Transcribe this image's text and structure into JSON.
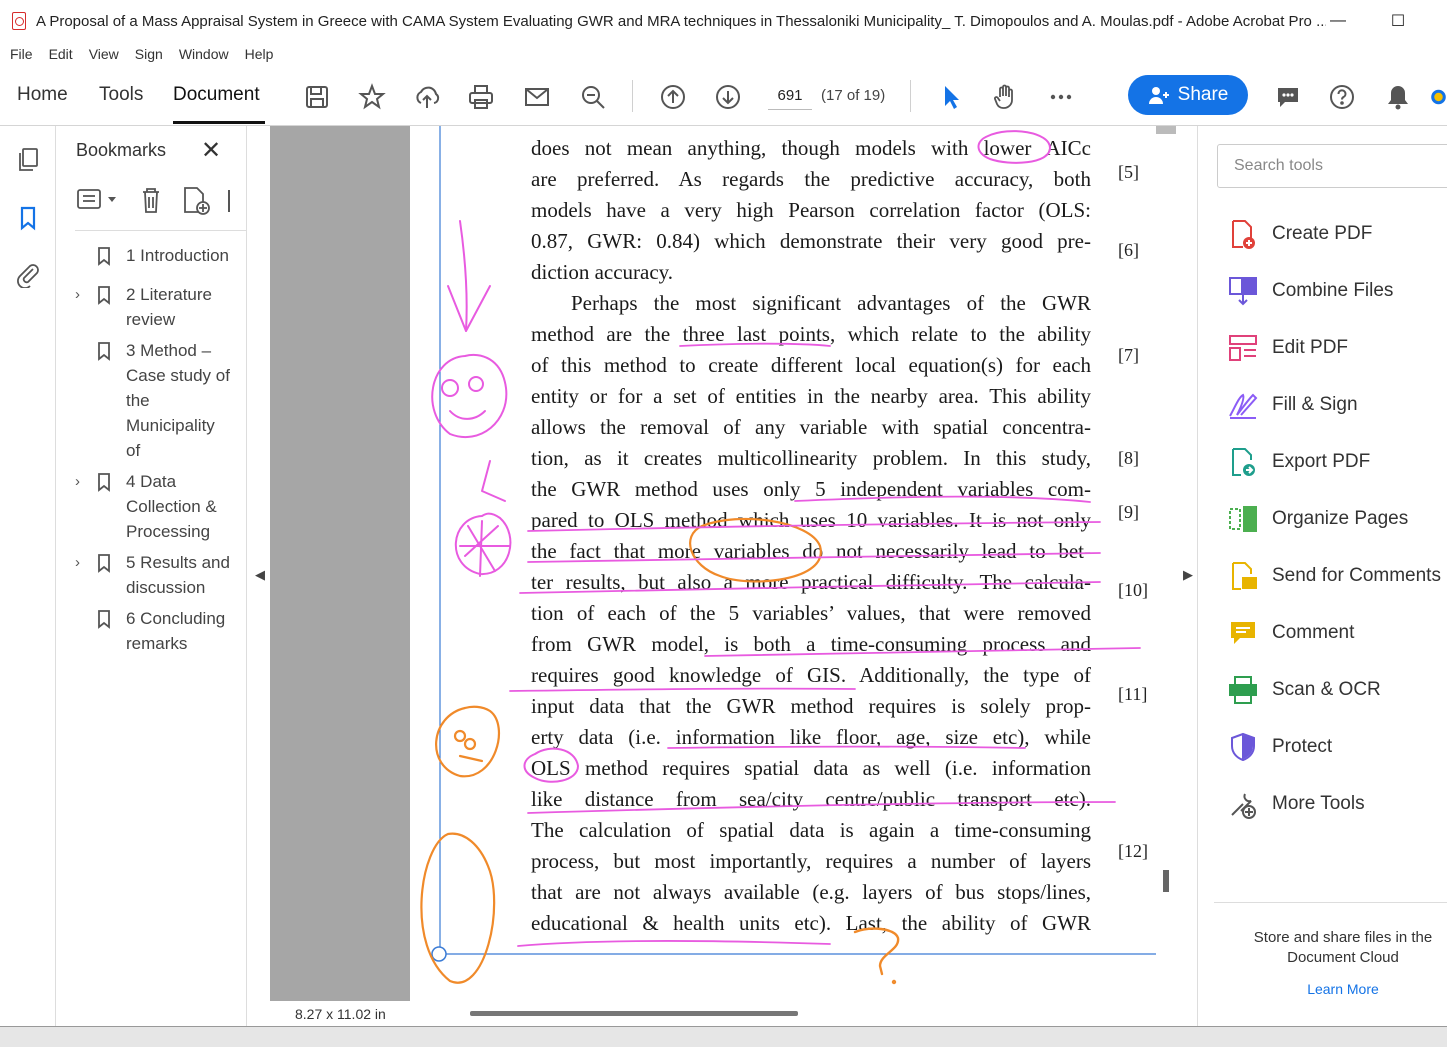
{
  "window": {
    "title": "A Proposal of a Mass Appraisal System in Greece with CAMA System Evaluating GWR and MRA techniques in Thessaloniki Municipality_ T. Dimopoulos and A. Moulas.pdf - Adobe Acrobat Pro ...",
    "minimize": "—",
    "maximize": "☐"
  },
  "menu": [
    "File",
    "Edit",
    "View",
    "Sign",
    "Window",
    "Help"
  ],
  "tabs": {
    "home": "Home",
    "tools": "Tools",
    "document": "Document"
  },
  "toolbar": {
    "page_value": "691",
    "page_count": "(17 of 19)",
    "share_label": "Share"
  },
  "bookmarks": {
    "title": "Bookmarks",
    "close": "✕",
    "items": [
      {
        "chevron": "",
        "lines": [
          "1 Introduction"
        ]
      },
      {
        "chevron": "›",
        "lines": [
          "2 Literature",
          "review"
        ]
      },
      {
        "chevron": "",
        "lines": [
          "3 Method –",
          "Case study of",
          "the",
          "Municipality",
          "of"
        ]
      },
      {
        "chevron": "›",
        "lines": [
          "4 Data",
          "Collection &",
          "Processing"
        ]
      },
      {
        "chevron": "›",
        "lines": [
          "5 Results and",
          "discussion"
        ]
      },
      {
        "chevron": "",
        "lines": [
          "6 Concluding",
          "remarks"
        ]
      }
    ]
  },
  "document": {
    "lines": [
      "does not mean anything, though models with lower AICc",
      "are preferred. As regards the predictive accuracy, both",
      "models have a very high Pearson correlation factor (OLS:",
      "0.87, GWR: 0.84) which demonstrate their very good pre-",
      "diction accuracy.",
      "Perhaps the most significant advantages of the GWR",
      "method are the three last points, which relate to the ability",
      "of this method to create different local equation(s) for each",
      "entity or for a set of entities in the nearby area. This ability",
      "allows the removal of any variable with spatial concentra-",
      "tion, as it creates multicollinearity problem. In this study,",
      "the GWR method uses only 5 independent variables com-",
      "pared to OLS method which uses 10 variables. It is not only",
      "the fact that more variables do not necessarily lead to bet-",
      "ter results, but also a more practical difficulty. The calcula-",
      "tion of each of the 5 variables’ values, that were removed",
      "from GWR model, is both a time-consuming process and",
      "requires good knowledge of GIS. Additionally, the type of",
      "input data that the GWR method requires is solely prop-",
      "erty data (i.e. information like floor, age, size etc), while",
      "OLS method requires spatial data as well (i.e. information",
      "like distance from sea/city centre/public transport etc).",
      "The calculation of spatial data is again a time-consuming",
      "process, but most importantly, requires a number of layers",
      "that are not always available (e.g. layers of bus stops/lines,",
      "educational & health units etc). Last, the ability of GWR"
    ],
    "refs": [
      "[5]",
      "[6]",
      "[7]",
      "[8]",
      "[9]",
      "[10]",
      "[11]",
      "[12]"
    ],
    "page_size": "8.27 x 11.02 in"
  },
  "tools_pane": {
    "search_placeholder": "Search tools",
    "items": [
      {
        "label": "Create PDF",
        "icon": "create-pdf-icon",
        "color": "#e0413a"
      },
      {
        "label": "Combine Files",
        "icon": "combine-files-icon",
        "color": "#6b57d9"
      },
      {
        "label": "Edit PDF",
        "icon": "edit-pdf-icon",
        "color": "#e0417a"
      },
      {
        "label": "Fill & Sign",
        "icon": "fill-sign-icon",
        "color": "#8b5cf6"
      },
      {
        "label": "Export PDF",
        "icon": "export-pdf-icon",
        "color": "#1e9e8c"
      },
      {
        "label": "Organize Pages",
        "icon": "organize-pages-icon",
        "color": "#4caf50"
      },
      {
        "label": "Send for Comments",
        "icon": "send-comments-icon",
        "color": "#e8b400"
      },
      {
        "label": "Comment",
        "icon": "comment-icon",
        "color": "#e8b400"
      },
      {
        "label": "Scan & OCR",
        "icon": "scan-ocr-icon",
        "color": "#2e9e4f"
      },
      {
        "label": "Protect",
        "icon": "protect-icon",
        "color": "#6b57d9"
      },
      {
        "label": "More Tools",
        "icon": "more-tools-icon",
        "color": "#555555"
      }
    ],
    "cloud_text": "Store and share files in the Document Cloud",
    "learn_more": "Learn More"
  },
  "colors": {
    "accent": "#1473e6",
    "ink_pink": "#e85be0",
    "ink_orange": "#f08a2a"
  }
}
